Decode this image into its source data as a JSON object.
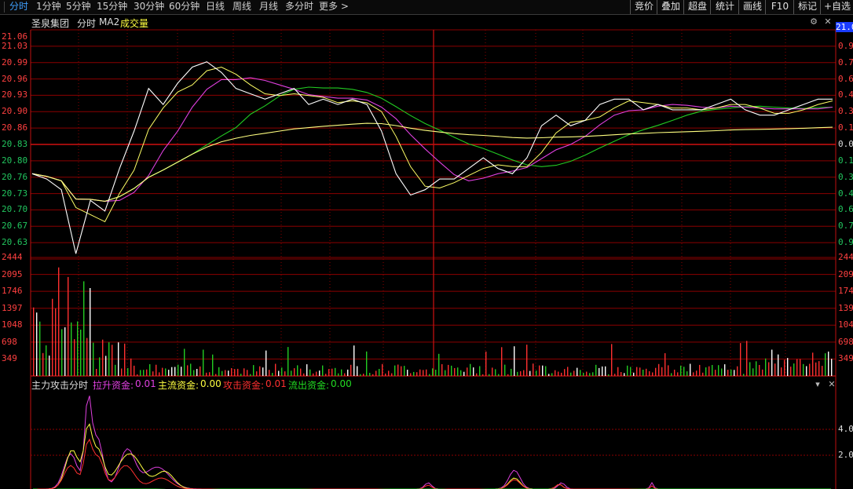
{
  "toolbar": {
    "periods": [
      "分时",
      "1分钟",
      "5分钟",
      "15分钟",
      "30分钟",
      "60分钟",
      "日线",
      "周线",
      "月线",
      "多分时",
      "更多"
    ],
    "active": "分时",
    "right_buttons": [
      "竞价",
      "叠加",
      "超盘",
      "统计",
      "画线",
      "F10",
      "标记",
      "+自选"
    ]
  },
  "price_panel": {
    "stock_name": "圣泉集团",
    "mode": "分时",
    "indicator": "MA2",
    "volume_label": "成交量",
    "y_left": [
      "21.06",
      "21.03",
      "20.99",
      "20.96",
      "20.93",
      "20.90",
      "20.86",
      "20.83",
      "20.80",
      "20.76",
      "20.73",
      "20.70",
      "20.67",
      "20.63"
    ],
    "y_right": [
      "21.0",
      "0.9",
      "0.7",
      "0.6",
      "0.4",
      "0.3",
      "0.1",
      "0.0",
      "0.1",
      "0.3",
      "0.4",
      "0.6",
      "0.7",
      "0.9"
    ],
    "current_price_tag": "21.0"
  },
  "volume_panel": {
    "y_left": [
      "2444",
      "2095",
      "1746",
      "1397",
      "1048",
      "698",
      "349"
    ],
    "y_right": [
      "244",
      "209",
      "174",
      "139",
      "104",
      "698",
      "349"
    ]
  },
  "flow_panel": {
    "title": "主力攻击分时",
    "items": [
      {
        "label": "拉升资金:",
        "value": "0.01",
        "color": "#e040e0"
      },
      {
        "label": "主流资金:",
        "value": "0.00",
        "color": "#ffff40"
      },
      {
        "label": "攻击资金:",
        "value": "0.01",
        "color": "#ff3030"
      },
      {
        "label": "流出资金:",
        "value": "0.00",
        "color": "#22dd22"
      }
    ],
    "y_right": [
      "4.0",
      "2.0"
    ]
  },
  "colors": {
    "grid": "#8b0000",
    "price_line": "#ffffff",
    "ma_yellow": "#ffff66",
    "ma_magenta": "#e040e0",
    "ma_green": "#22cc22",
    "avg_line": "#ffff80",
    "up_bar": "#ff3030",
    "down_bar": "#22cc22",
    "flat_bar": "#ffffff"
  },
  "chart_data": {
    "type": "line",
    "title": "圣泉集团 分时",
    "y_axis_range": [
      20.63,
      21.06
    ],
    "series": [
      {
        "name": "分时",
        "values": [
          20.79,
          20.78,
          20.76,
          20.64,
          20.74,
          20.72,
          20.8,
          20.87,
          20.95,
          20.92,
          20.96,
          20.99,
          21.0,
          20.98,
          20.95,
          20.94,
          20.93,
          20.94,
          20.95,
          20.92,
          20.93,
          20.92,
          20.93,
          20.92,
          20.87,
          20.79,
          20.75,
          20.76,
          20.78,
          20.78,
          20.8,
          20.82,
          20.8,
          20.79,
          20.82,
          20.88,
          20.9,
          20.88,
          20.89,
          20.92,
          20.93,
          20.93,
          20.91,
          20.92,
          20.91,
          20.91,
          20.91,
          20.92,
          20.93,
          20.91,
          20.9,
          20.9,
          20.91,
          20.92,
          20.93,
          20.93
        ]
      }
    ]
  }
}
